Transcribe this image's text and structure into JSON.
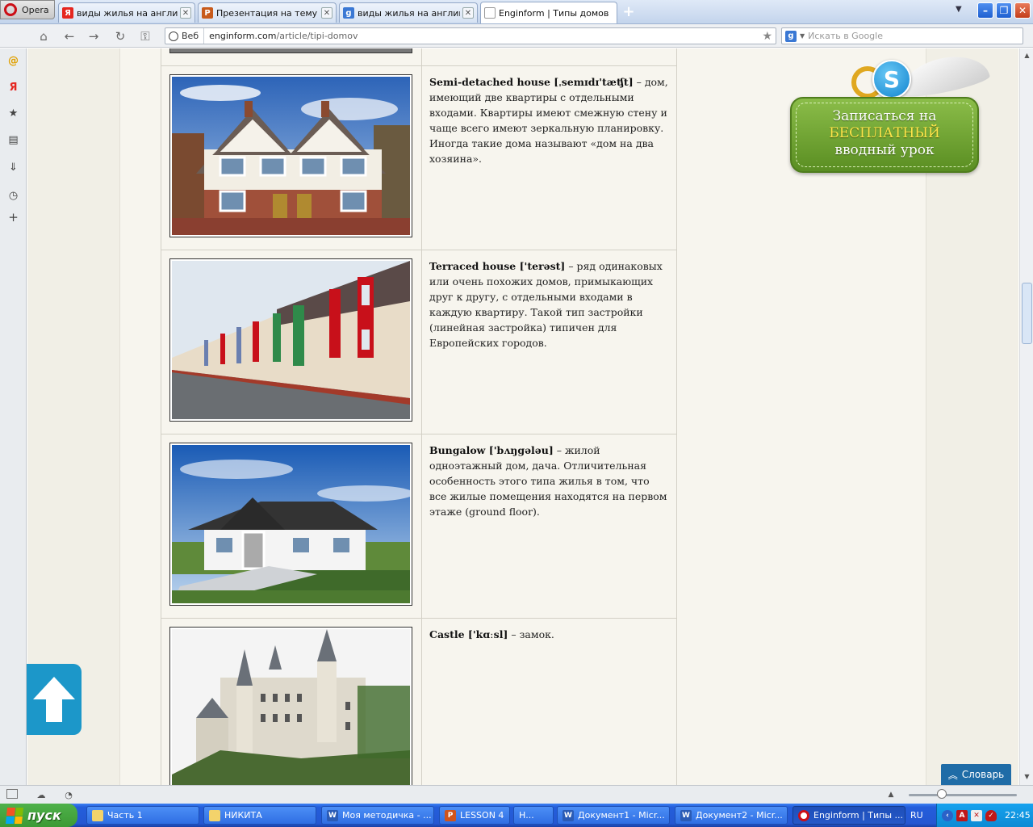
{
  "browser": {
    "menu_label": "Opera",
    "tabs": [
      {
        "label": "виды жилья на английс...",
        "icon": "Я",
        "icon_color": "#e52620"
      },
      {
        "label": "Презентация на тему \"...",
        "icon": "P",
        "icon_color": "#c85b1c"
      },
      {
        "label": "виды жилья на английс...",
        "icon": "g",
        "icon_color": "#3a78d4"
      },
      {
        "label": "Enginform | Типы домов",
        "icon": "",
        "icon_color": "#ffffff"
      }
    ],
    "address": {
      "web_label": "Веб",
      "url_host": "enginform.com",
      "url_path": "/article/tipi-domov"
    },
    "search_placeholder": "Искать в Google"
  },
  "article": {
    "rows": [
      {
        "term": "Semi-detached house [ˌsemɪdɪ'tæʧt]",
        "text": " – дом, имеющий две квартиры с отдельными входами. Квартиры имеют смежную стену и чаще всего имеют зеркальную планировку. Иногда такие дома называют «дом на два хозяина»."
      },
      {
        "term": "Terraced house ['terəst]",
        "text": " – ряд одинаковых или очень похожих домов, примыкающих друг к другу, с отдельными входами в каждую квартиру. Такой тип застройки (линейная застройка) типичен для Европейских городов."
      },
      {
        "term": "Bungalow ['bʌŋgələu]",
        "text": " – жилой одноэтажный дом, дача. Отличительная особенность этого типа жилья в том, что все жилые помещения находятся на первом этаже (ground floor)."
      },
      {
        "term": "Castle ['kɑːsl]",
        "text": " – замок."
      }
    ]
  },
  "promo": {
    "line1": "Записаться на",
    "line2": "БЕСПЛАТНЫЙ",
    "line3": "вводный урок"
  },
  "dictionary_label": "Словарь",
  "taskbar": {
    "start_label": "пуск",
    "items": [
      {
        "label": "Часть 1",
        "icon": "folder-icon"
      },
      {
        "label": "НИКИТА",
        "icon": "folder-icon"
      },
      {
        "label": "Моя методичка - ...",
        "icon": "word-icon"
      },
      {
        "label": "LESSON 4",
        "icon": "powerpoint-icon"
      },
      {
        "label": "Н...",
        "icon": "word-icon"
      },
      {
        "label": "Документ1 - Micr...",
        "icon": "word-icon"
      },
      {
        "label": "Документ2 - Micr...",
        "icon": "word-icon"
      },
      {
        "label": "Enginform | Типы ...",
        "icon": "opera-icon"
      }
    ],
    "language": "RU",
    "clock": "22:45"
  },
  "colors": {
    "promo_green": "#6fa233",
    "up_button": "#1c97c9",
    "dictionary": "#1f6ca7"
  }
}
